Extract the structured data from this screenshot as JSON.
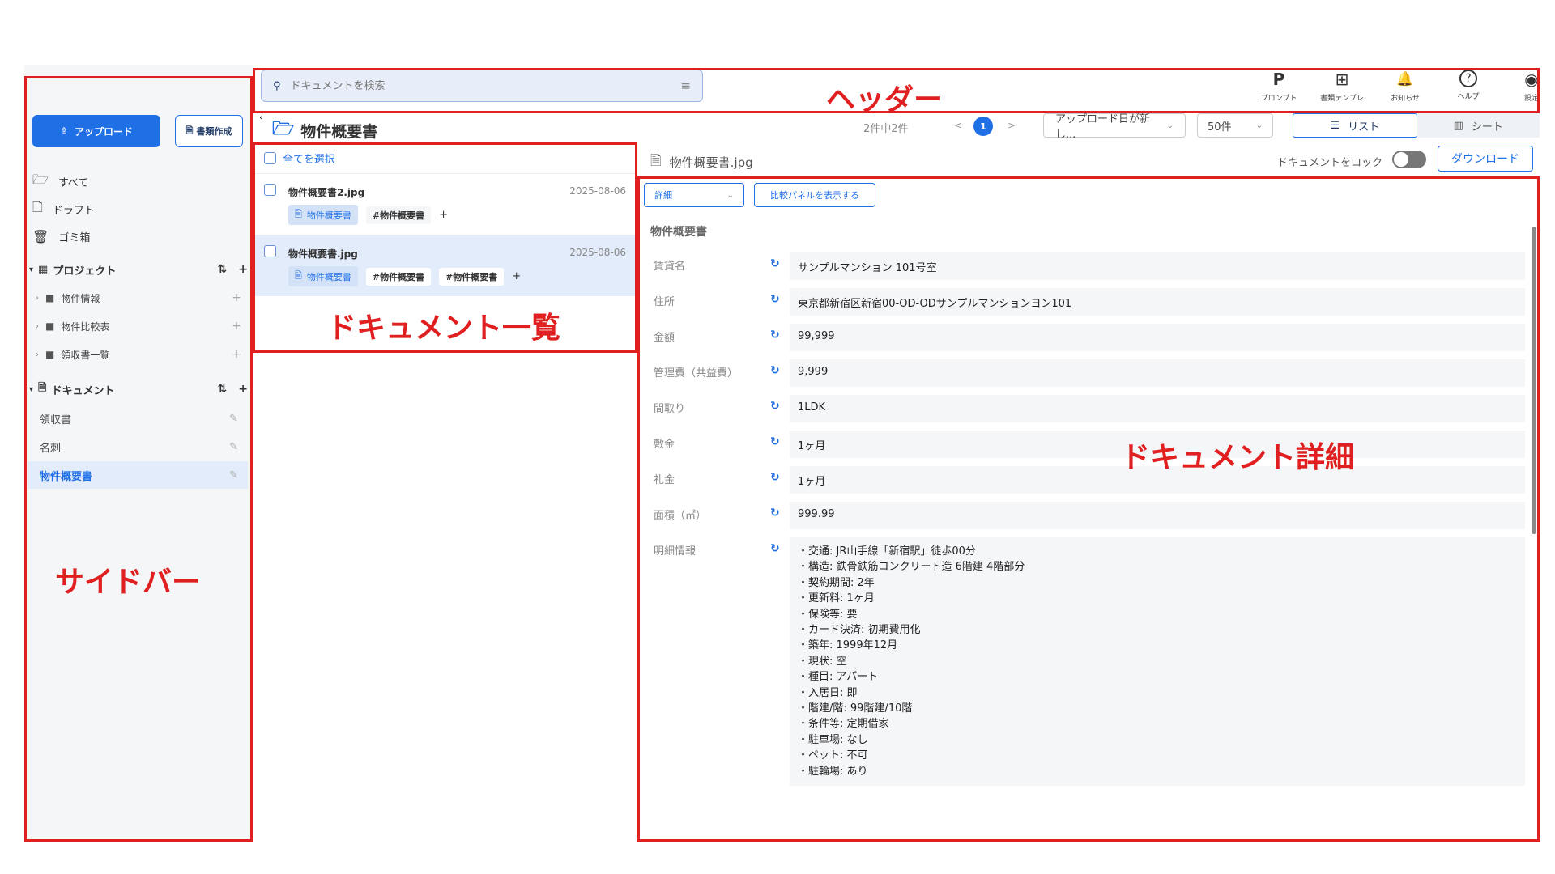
{
  "sidebar": {
    "upload_label": "アップロード",
    "create_label": "書類作成",
    "nav": [
      "すべて",
      "ドラフト",
      "ゴミ箱"
    ],
    "projects_label": "プロジェクト",
    "projects": [
      "物件情報",
      "物件比較表",
      "領収書一覧"
    ],
    "documents_label": "ドキュメント",
    "documents": [
      "領収書",
      "名刺",
      "物件概要書"
    ],
    "active_document": "物件概要書"
  },
  "header": {
    "search_placeholder": "ドキュメントを検索",
    "icons": [
      {
        "glyph": "P",
        "label": "プロンプト"
      },
      {
        "glyph": "⊞",
        "label": "書類テンプレ"
      },
      {
        "glyph": "🔔",
        "label": "お知らせ"
      },
      {
        "glyph": "?",
        "label": "ヘルプ"
      },
      {
        "glyph": "◉",
        "label": "設定"
      }
    ]
  },
  "titlebar": {
    "title": "物件概要書",
    "count": "2件中2件",
    "prev": "<",
    "page": "1",
    "next": ">",
    "sort": "アップロード日が新し...",
    "per_page": "50件",
    "view_list": "リスト",
    "view_sheet": "シート"
  },
  "doclist": {
    "select_all": "全てを選択",
    "rows": [
      {
        "name": "物件概要書2.jpg",
        "date": "2025-08-06",
        "type_tag": "物件概要書",
        "tags": [
          "#物件概要書"
        ]
      },
      {
        "name": "物件概要書.jpg",
        "date": "2025-08-06",
        "type_tag": "物件概要書",
        "tags": [
          "#物件概要書",
          "#物件概要書"
        ]
      }
    ],
    "add_tag": "+"
  },
  "detail": {
    "file_name": "物件概要書.jpg",
    "lock_label": "ドキュメントをロック",
    "download_label": "ダウンロード",
    "mode_select": "詳細",
    "compare_label": "比較パネルを表示する",
    "section_title": "物件概要書",
    "fields": [
      {
        "label": "賃貸名",
        "value": "サンプルマンション 101号室"
      },
      {
        "label": "住所",
        "value": "東京都新宿区新宿00-OD-ODサンプルマンションヨン101"
      },
      {
        "label": "金額",
        "value": "99,999"
      },
      {
        "label": "管理費（共益費）",
        "value": "9,999"
      },
      {
        "label": "間取り",
        "value": "1LDK"
      },
      {
        "label": "敷金",
        "value": "1ヶ月"
      },
      {
        "label": "礼金",
        "value": "1ヶ月"
      },
      {
        "label": "面積（㎡）",
        "value": "999.99"
      }
    ],
    "details_label": "明細情報",
    "details_lines": [
      "・交通: JR山手線「新宿駅」徒歩00分",
      "・構造: 鉄骨鉄筋コンクリート造 6階建 4階部分",
      "・契約期間: 2年",
      "・更新料: 1ヶ月",
      "・保険等: 要",
      "・カード決済: 初期費用化",
      "・築年: 1999年12月",
      "・現状: 空",
      "・種目: アパート",
      "・入居日: 即",
      "・階建/階: 99階建/10階",
      "・条件等: 定期借家",
      "・駐車場: なし",
      "・ペット: 不可",
      "・駐輪場: あり"
    ]
  },
  "annotations": {
    "header": "ヘッダー",
    "sidebar": "サイドバー",
    "doclist": "ドキュメント一覧",
    "detail": "ドキュメント詳細"
  }
}
